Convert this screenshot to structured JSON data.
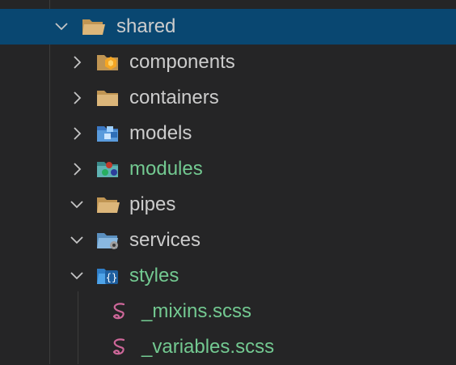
{
  "explorer": {
    "root": {
      "label": "shared",
      "icon": "folder-open-icon",
      "expanded": true
    },
    "items": [
      {
        "label": "components",
        "icon": "folder-components-icon",
        "expanded": false,
        "color": "default"
      },
      {
        "label": "containers",
        "icon": "folder-icon",
        "expanded": false,
        "color": "default"
      },
      {
        "label": "models",
        "icon": "folder-models-icon",
        "expanded": false,
        "color": "default"
      },
      {
        "label": "modules",
        "icon": "folder-modules-icon",
        "expanded": false,
        "color": "#73c991"
      },
      {
        "label": "pipes",
        "icon": "folder-open-icon",
        "expanded": true,
        "color": "default"
      },
      {
        "label": "services",
        "icon": "folder-services-icon",
        "expanded": true,
        "color": "default"
      },
      {
        "label": "styles",
        "icon": "folder-styles-icon",
        "expanded": true,
        "color": "#73c991"
      }
    ],
    "files": [
      {
        "label": "_mixins.scss",
        "icon": "sass-icon",
        "color": "#73c991"
      },
      {
        "label": "_variables.scss",
        "icon": "sass-icon",
        "color": "#73c991"
      }
    ]
  },
  "colors": {
    "background": "#252526",
    "selection": "#094771",
    "text": "#cccccc",
    "modified": "#73c991",
    "sass": "#cd6799"
  }
}
